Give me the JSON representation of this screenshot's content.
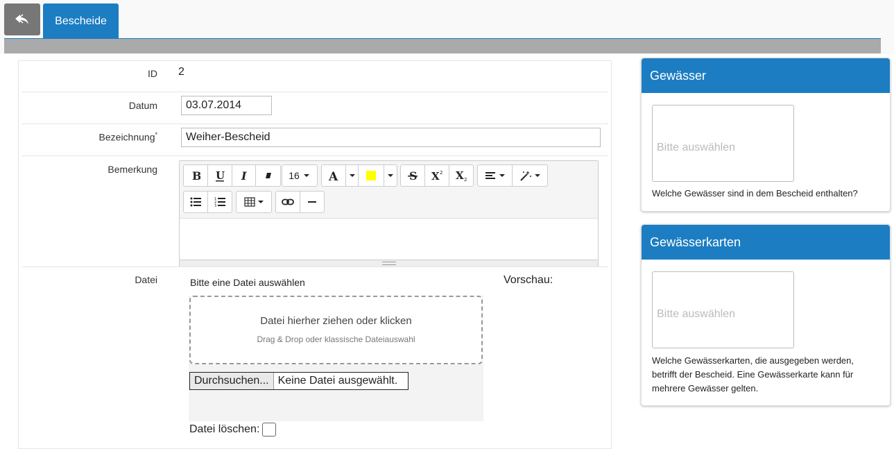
{
  "topbar": {
    "active_tab": "Bescheide"
  },
  "form": {
    "id_label": "ID",
    "id_value": "2",
    "datum_label": "Datum",
    "datum_value": "03.07.2014",
    "bezeichnung_label": "Bezeichnung",
    "required_marker": "*",
    "bezeichnung_value": "Weiher-Bescheid",
    "bemerkung_label": "Bemerkung",
    "font_size": "16",
    "datei_label": "Datei",
    "file_hint": "Bitte eine Datei auswählen",
    "dropzone_title": "Datei hierher ziehen oder klicken",
    "dropzone_sub": "Drag & Drop oder klassische Dateiauswahl",
    "browse_label": "Durchsuchen...",
    "no_file_label": "Keine Datei ausgewählt.",
    "delete_label": "Datei löschen:",
    "preview_label": "Vorschau:"
  },
  "cards": {
    "gewaesser": {
      "title": "Gewässer",
      "placeholder": "Bitte auswählen",
      "help": "Welche Gewässer sind in dem Bescheid enthalten?"
    },
    "karten": {
      "title": "Gewässerkarten",
      "placeholder": "Bitte auswählen",
      "help": "Welche Gewässerkarten, die ausgegeben werden, betrifft der Bescheid. Eine Gewässerkarte kann für mehrere Gewässer gelten."
    }
  },
  "colors": {
    "accent": "#1c7dc2",
    "back_button": "#777777",
    "band": "#aaaaaa",
    "highlight": "#ffff00"
  },
  "icons": [
    "back-arrow-icon",
    "bold-icon",
    "underline-icon",
    "italic-icon",
    "eraser-icon",
    "font-color-icon",
    "highlight-color-icon",
    "strikethrough-icon",
    "superscript-icon",
    "subscript-icon",
    "align-icon",
    "magic-wand-icon",
    "bullet-list-icon",
    "numbered-list-icon",
    "table-icon",
    "link-icon",
    "horizontal-rule-icon"
  ]
}
